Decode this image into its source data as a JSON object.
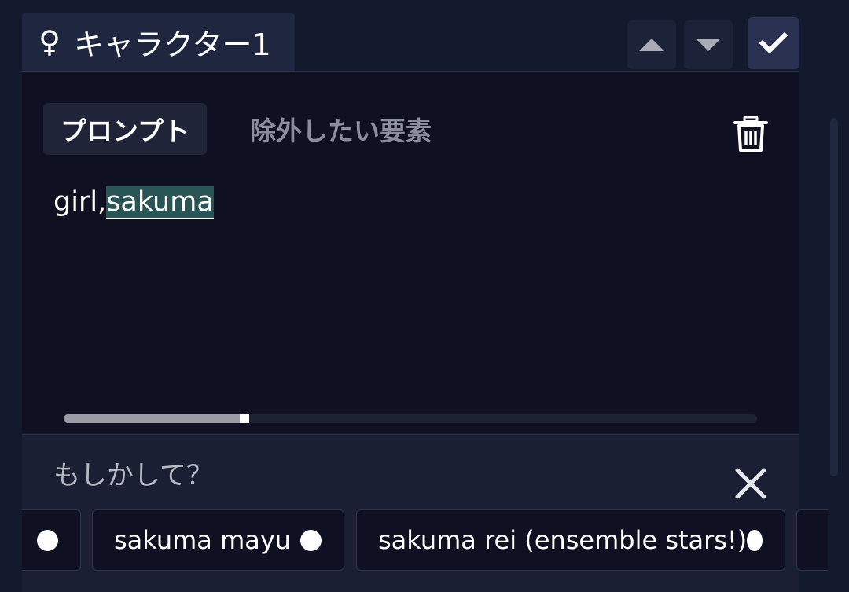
{
  "character": {
    "gender_symbol": "♀",
    "name": "キャラクター1"
  },
  "controls": {
    "move_up": "caret-up-icon",
    "move_down": "caret-down-icon",
    "confirm": "check-icon"
  },
  "tabs": {
    "prompt_label": "プロンプト",
    "negative_label": "除外したい要素",
    "active": "prompt"
  },
  "prompt": {
    "text_plain": "girl,",
    "text_highlighted": "sakuma"
  },
  "suggestions": {
    "title": "もしかして？",
    "items": [
      {
        "label": ""
      },
      {
        "label": "sakuma mayu"
      },
      {
        "label": "sakuma rei (ensemble stars!)"
      },
      {
        "label": ""
      }
    ]
  },
  "colors": {
    "background": "#141a2e",
    "editor_background": "#0f1123",
    "highlight": "#2a5557",
    "inactive_tab_text": "#8a8d9e"
  }
}
